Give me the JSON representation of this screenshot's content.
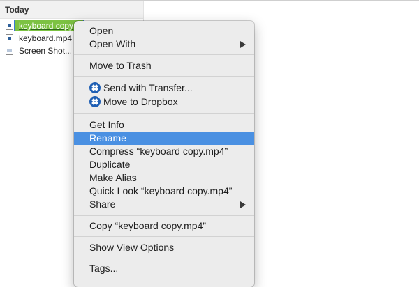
{
  "finder": {
    "section_header": "Today",
    "files": [
      {
        "name": "keyboard copy.mp4",
        "display": "keyboard copy",
        "icon": "video-file-icon",
        "selected": true
      },
      {
        "name": "keyboard.mp4",
        "display": "keyboard.mp4",
        "icon": "video-file-icon",
        "selected": false
      },
      {
        "name": "Screen Shot",
        "display": "Screen Shot...",
        "icon": "image-file-icon",
        "selected": false
      }
    ]
  },
  "context_menu": {
    "items": {
      "open": "Open",
      "open_with": "Open With",
      "move_to_trash": "Move to Trash",
      "send_with_transfer": "Send with Transfer...",
      "move_to_dropbox": "Move to Dropbox",
      "get_info": "Get Info",
      "rename": "Rename",
      "compress": "Compress “keyboard copy.mp4”",
      "duplicate": "Duplicate",
      "make_alias": "Make Alias",
      "quick_look": "Quick Look “keyboard copy.mp4”",
      "share": "Share",
      "copy": "Copy “keyboard copy.mp4”",
      "show_view_options": "Show View Options",
      "tags": "Tags..."
    },
    "highlighted": "Rename",
    "colors": {
      "highlight": "#4a90e2",
      "menu_bg": "#ececec",
      "dropbox_icon": "#1f5fb4",
      "selection_green": "#7cc242"
    }
  }
}
